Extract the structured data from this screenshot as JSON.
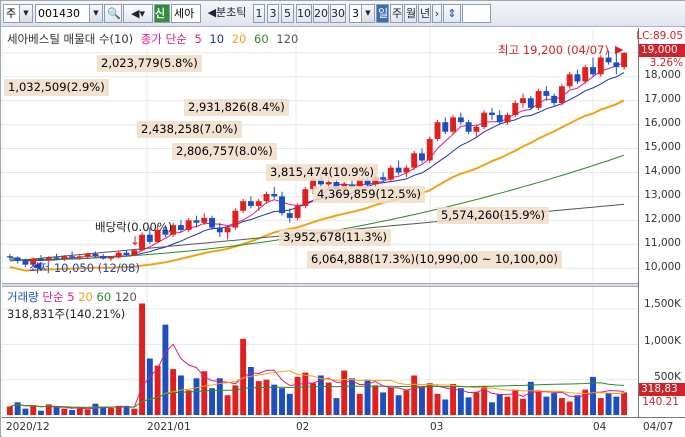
{
  "toolbar": {
    "market_code": "주",
    "stock_code": "001430",
    "stock_name": "세아",
    "tag_new": "신",
    "period_label": "분초틱",
    "intervals": [
      "1",
      "3",
      "5",
      "10",
      "20",
      "30"
    ],
    "interval_value": "3",
    "period_day": "일",
    "period_week": "주",
    "period_month": "월",
    "period_year": "년"
  },
  "price_legend": {
    "title": "세아베스틸 매물대 수(10)",
    "ma_label": "종가 단순",
    "ma_periods": [
      "5",
      "10",
      "20",
      "60",
      "120"
    ]
  },
  "volume_legend": {
    "title": "거래량",
    "ma_label": "단순",
    "ma_periods": [
      "5",
      "20",
      "60",
      "120"
    ],
    "current": "318,831주(140.21%)"
  },
  "volume_profile": [
    "2,023,779(5.8%)",
    "1,032,509(2.9%)",
    "2,931,826(8.4%)",
    "2,438,258(7.0%)",
    "2,806,757(8.0%)",
    "3,815,474(10.9%)",
    "4,369,859(12.5%)",
    "5,574,260(15.9%)",
    "3,952,678(11.3%)",
    "6,064,888(17.3%)(10,990,00 ~ 10,100,00)"
  ],
  "annotations": {
    "high": "최고 19,200 (04/07)",
    "low": "최저 10,050 (12/08)",
    "dividend": "배당락(0.00%)"
  },
  "right_axis": {
    "lc": "LC:89.05",
    "current_price": "19,000",
    "change_pct": "3.26%",
    "price_ticks": [
      "18,000",
      "17,000",
      "16,000",
      "15,000",
      "14,000",
      "13,000",
      "12,000",
      "11,000",
      "10,000"
    ],
    "volume_ticks": [
      "1,500K",
      "1,000K",
      "500K"
    ],
    "current_volume": "318,83",
    "volume_ratio": "140.21"
  },
  "x_axis": {
    "ticks": [
      "2020/12",
      "2021/01",
      "02",
      "03",
      "04"
    ],
    "right_label": "04/07"
  },
  "colors": {
    "up": "#e0201e",
    "down": "#1c4fc0",
    "ma5": "#d81b8c",
    "ma10": "#1733b5",
    "ma20": "#f0a315",
    "ma60": "#2a8a2a",
    "ma120": "#555555"
  },
  "chart_data": {
    "type": "candlestick",
    "price_range": [
      10000,
      19200
    ],
    "candles": [
      [
        10500,
        10600,
        10350,
        10450
      ],
      [
        10450,
        10500,
        10200,
        10300
      ],
      [
        10300,
        10400,
        10050,
        10150
      ],
      [
        10150,
        10450,
        10100,
        10400
      ],
      [
        10400,
        10550,
        10300,
        10350
      ],
      [
        10350,
        10500,
        10250,
        10450
      ],
      [
        10450,
        10600,
        10350,
        10400
      ],
      [
        10400,
        10550,
        10300,
        10500
      ],
      [
        10500,
        10700,
        10400,
        10450
      ],
      [
        10450,
        10550,
        10350,
        10500
      ],
      [
        10500,
        10650,
        10400,
        10600
      ],
      [
        10600,
        10700,
        10450,
        10500
      ],
      [
        10500,
        10600,
        10350,
        10400
      ],
      [
        10400,
        10500,
        10300,
        10450
      ],
      [
        10450,
        10700,
        10400,
        10650
      ],
      [
        10650,
        10750,
        10500,
        10550
      ],
      [
        10550,
        10800,
        10500,
        10750
      ],
      [
        10750,
        11500,
        10700,
        11400
      ],
      [
        11400,
        11700,
        11000,
        11100
      ],
      [
        11100,
        11800,
        11050,
        11600
      ],
      [
        11600,
        11800,
        11300,
        11400
      ],
      [
        11400,
        11900,
        11300,
        11800
      ],
      [
        11800,
        12000,
        11500,
        11600
      ],
      [
        11600,
        12100,
        11500,
        12000
      ],
      [
        12000,
        12200,
        11700,
        11900
      ],
      [
        11900,
        12300,
        11800,
        12100
      ],
      [
        12100,
        12200,
        11600,
        11700
      ],
      [
        11700,
        11900,
        11300,
        11500
      ],
      [
        11500,
        11800,
        11200,
        11700
      ],
      [
        11700,
        12500,
        11600,
        12400
      ],
      [
        12400,
        12900,
        12300,
        12800
      ],
      [
        12800,
        13000,
        12500,
        12600
      ],
      [
        12600,
        12900,
        12400,
        12800
      ],
      [
        12800,
        13200,
        12700,
        13100
      ],
      [
        13100,
        13400,
        12900,
        13000
      ],
      [
        13000,
        13200,
        12200,
        12300
      ],
      [
        12300,
        12500,
        11900,
        12100
      ],
      [
        12100,
        12700,
        12000,
        12600
      ],
      [
        12600,
        13400,
        12500,
        13300
      ],
      [
        13300,
        13800,
        13100,
        13700
      ],
      [
        13700,
        13900,
        13400,
        13500
      ],
      [
        13500,
        13800,
        13300,
        13600
      ],
      [
        13600,
        13700,
        13200,
        13300
      ],
      [
        13300,
        13600,
        13200,
        13500
      ],
      [
        13500,
        13700,
        13300,
        13400
      ],
      [
        13400,
        13800,
        13300,
        13700
      ],
      [
        13700,
        13800,
        13400,
        13500
      ],
      [
        13500,
        13900,
        13400,
        13800
      ],
      [
        13800,
        14000,
        13600,
        13700
      ],
      [
        13700,
        14300,
        13600,
        14200
      ],
      [
        14200,
        14500,
        13900,
        14000
      ],
      [
        14000,
        14300,
        13800,
        14200
      ],
      [
        14200,
        14900,
        14100,
        14800
      ],
      [
        14800,
        15000,
        14400,
        14500
      ],
      [
        14500,
        15500,
        14400,
        15400
      ],
      [
        15400,
        16200,
        15300,
        16100
      ],
      [
        16100,
        16300,
        15600,
        15700
      ],
      [
        15700,
        16400,
        15600,
        16300
      ],
      [
        16300,
        16500,
        16000,
        16100
      ],
      [
        16100,
        16200,
        15600,
        15700
      ],
      [
        15700,
        16000,
        15500,
        15900
      ],
      [
        15900,
        16600,
        15800,
        16500
      ],
      [
        16500,
        16700,
        16200,
        16400
      ],
      [
        16400,
        16600,
        16000,
        16100
      ],
      [
        16100,
        16500,
        16000,
        16400
      ],
      [
        16400,
        17000,
        16300,
        16900
      ],
      [
        16900,
        17300,
        16700,
        17100
      ],
      [
        17100,
        17200,
        16600,
        16700
      ],
      [
        16700,
        17500,
        16600,
        17400
      ],
      [
        17400,
        17600,
        17000,
        17200
      ],
      [
        17200,
        17300,
        16800,
        16900
      ],
      [
        16900,
        17700,
        16800,
        17600
      ],
      [
        17600,
        18200,
        17500,
        18100
      ],
      [
        18100,
        18300,
        17700,
        17800
      ],
      [
        17800,
        18500,
        17700,
        18400
      ],
      [
        18400,
        18800,
        18000,
        18100
      ],
      [
        18100,
        18900,
        18000,
        18800
      ],
      [
        18800,
        19100,
        18500,
        18600
      ],
      [
        18600,
        19200,
        18100,
        18400
      ],
      [
        18400,
        19000,
        18300,
        19000
      ]
    ],
    "volumes": [
      120,
      180,
      90,
      140,
      60,
      150,
      110,
      90,
      70,
      95,
      80,
      160,
      120,
      100,
      130,
      110,
      90,
      1580,
      800,
      700,
      1280,
      650,
      560,
      350,
      520,
      620,
      380,
      520,
      280,
      420,
      1080,
      680,
      480,
      500,
      430,
      380,
      300,
      540,
      600,
      450,
      560,
      460,
      240,
      630,
      520,
      300,
      500,
      420,
      320,
      390,
      280,
      350,
      560,
      390,
      450,
      300,
      220,
      440,
      380,
      250,
      320,
      410,
      180,
      290,
      260,
      360,
      230,
      470,
      330,
      260,
      310,
      240,
      190,
      280,
      360,
      540,
      240,
      310,
      260,
      320
    ],
    "up_flags": [
      1,
      0,
      0,
      1,
      0,
      1,
      0,
      1,
      0,
      1,
      1,
      0,
      0,
      1,
      1,
      0,
      1,
      1,
      0,
      1,
      0,
      1,
      0,
      1,
      0,
      1,
      0,
      0,
      1,
      1,
      1,
      0,
      1,
      1,
      0,
      0,
      0,
      1,
      1,
      1,
      0,
      1,
      0,
      1,
      0,
      1,
      0,
      1,
      0,
      1,
      0,
      1,
      1,
      0,
      1,
      1,
      0,
      1,
      0,
      0,
      1,
      1,
      0,
      0,
      1,
      1,
      1,
      0,
      1,
      0,
      0,
      1,
      1,
      0,
      1,
      0,
      1,
      0,
      0,
      1
    ]
  }
}
